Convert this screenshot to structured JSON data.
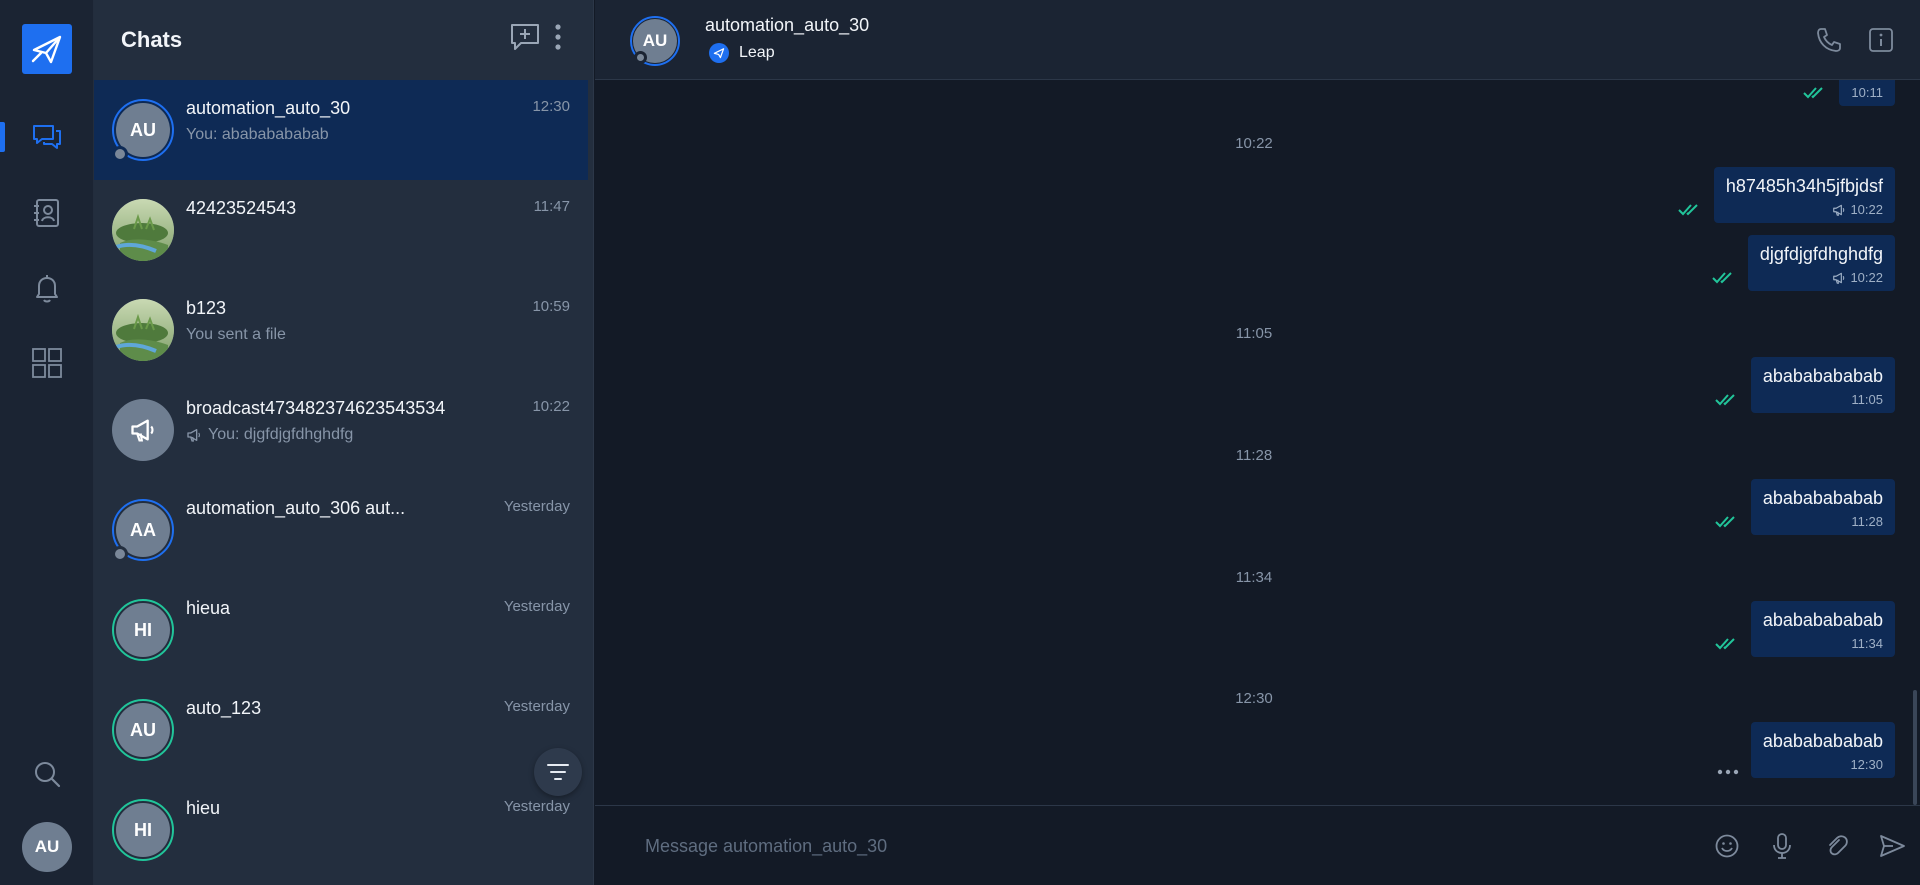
{
  "sidebar": {
    "nav": [
      {
        "icon": "chat-icon",
        "active": true
      },
      {
        "icon": "contacts-icon",
        "active": false
      },
      {
        "icon": "bell-icon",
        "active": false
      },
      {
        "icon": "apps-grid-icon",
        "active": false
      }
    ],
    "user_initials": "AU"
  },
  "chat_list": {
    "title": "Chats",
    "items": [
      {
        "name": "automation_auto_30",
        "time": "12:30",
        "preview": "You: abababababab",
        "initials": "AU",
        "avatar": "initials",
        "ring": "blue",
        "presence": true,
        "active": true
      },
      {
        "name": "42423524543",
        "time": "11:47",
        "preview": "",
        "initials": "",
        "avatar": "photo",
        "ring": "none",
        "presence": false,
        "active": false
      },
      {
        "name": "b123",
        "time": "10:59",
        "preview": "You sent a file",
        "initials": "",
        "avatar": "photo",
        "ring": "none",
        "presence": false,
        "active": false
      },
      {
        "name": "broadcast473482374623543534",
        "time": "10:22",
        "preview": "You: djgfdjgfdhghdfg",
        "initials": "",
        "avatar": "broadcast",
        "ring": "none",
        "presence": false,
        "active": false
      },
      {
        "name": "automation_auto_306 aut...",
        "time": "Yesterday",
        "preview": "",
        "initials": "AA",
        "avatar": "initials",
        "ring": "blue",
        "presence": true,
        "active": false
      },
      {
        "name": "hieua",
        "time": "Yesterday",
        "preview": "",
        "initials": "HI",
        "avatar": "initials",
        "ring": "green",
        "presence": false,
        "active": false
      },
      {
        "name": "auto_123",
        "time": "Yesterday",
        "preview": "",
        "initials": "AU",
        "avatar": "initials",
        "ring": "green",
        "presence": false,
        "active": false
      },
      {
        "name": "hieu",
        "time": "Yesterday",
        "preview": "",
        "initials": "HI",
        "avatar": "initials",
        "ring": "green",
        "presence": false,
        "active": false
      }
    ]
  },
  "conversation": {
    "name": "automation_auto_30",
    "initials": "AU",
    "workspace": "Leap",
    "timestamps": [
      "10:22",
      "11:05",
      "11:28",
      "11:34",
      "12:30"
    ],
    "messages": [
      {
        "text": "",
        "time": "10:11",
        "broadcast": false,
        "status": "read"
      },
      {
        "text": "h87485h34h5jfbjdsf",
        "time": "10:22",
        "broadcast": true,
        "status": "read"
      },
      {
        "text": "djgfdjgfdhghdfg",
        "time": "10:22",
        "broadcast": true,
        "status": "read"
      },
      {
        "text": "abababababab",
        "time": "11:05",
        "broadcast": false,
        "status": "read"
      },
      {
        "text": "abababababab",
        "time": "11:28",
        "broadcast": false,
        "status": "read"
      },
      {
        "text": "abababababab",
        "time": "11:34",
        "broadcast": false,
        "status": "read"
      },
      {
        "text": "abababababab",
        "time": "12:30",
        "broadcast": false,
        "status": "pending"
      }
    ],
    "composer_placeholder": "Message automation_auto_30"
  },
  "colors": {
    "accent": "#1e6ff0",
    "read_tick": "#21c59a",
    "bubble": "#0e2a55"
  }
}
